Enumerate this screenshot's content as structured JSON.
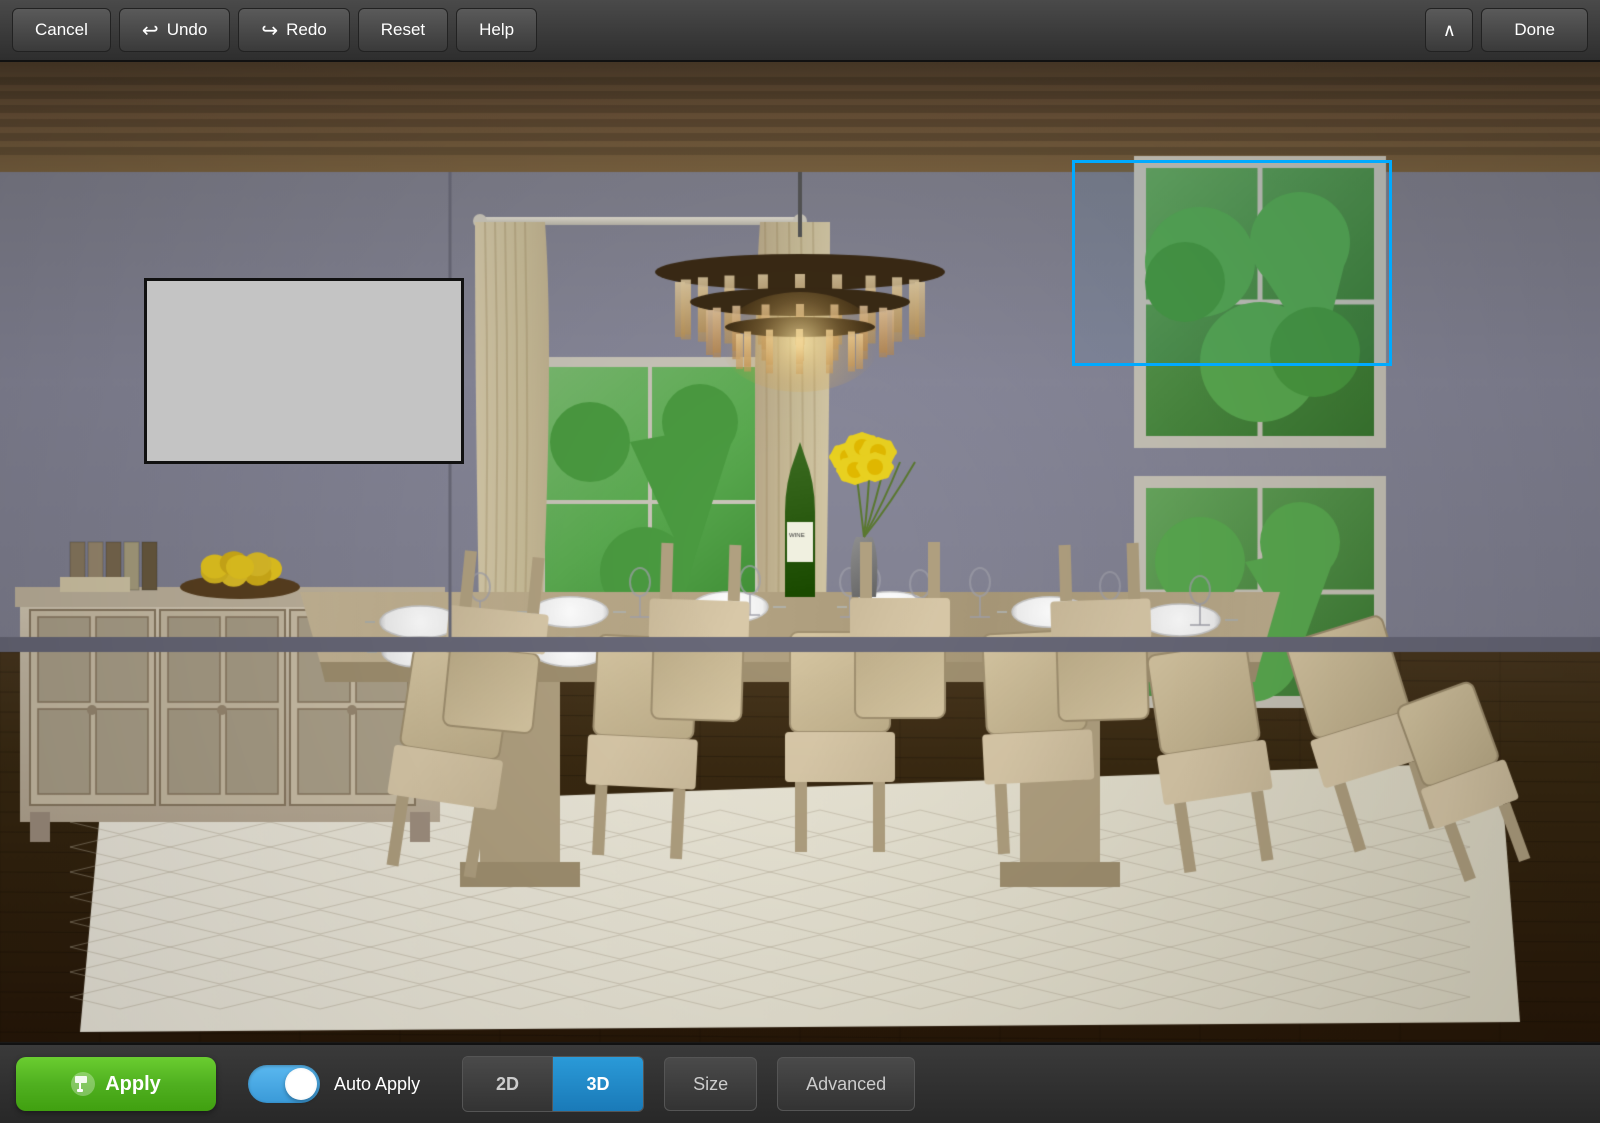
{
  "toolbar": {
    "cancel_label": "Cancel",
    "undo_label": "Undo",
    "redo_label": "Redo",
    "reset_label": "Reset",
    "help_label": "Help",
    "done_label": "Done"
  },
  "bottom_toolbar": {
    "apply_label": "Apply",
    "auto_apply_label": "Auto Apply",
    "view_2d_label": "2D",
    "view_3d_label": "3D",
    "size_label": "Size",
    "advanced_label": "Advanced",
    "toggle_state": "on",
    "active_view": "3D"
  },
  "scene": {
    "description": "Dining room 3D render with chandelier, dining table, chairs, sideboard"
  },
  "icons": {
    "undo_icon": "↩",
    "redo_icon": "↪",
    "paint_icon": "✏",
    "chevron_up": "∧"
  }
}
